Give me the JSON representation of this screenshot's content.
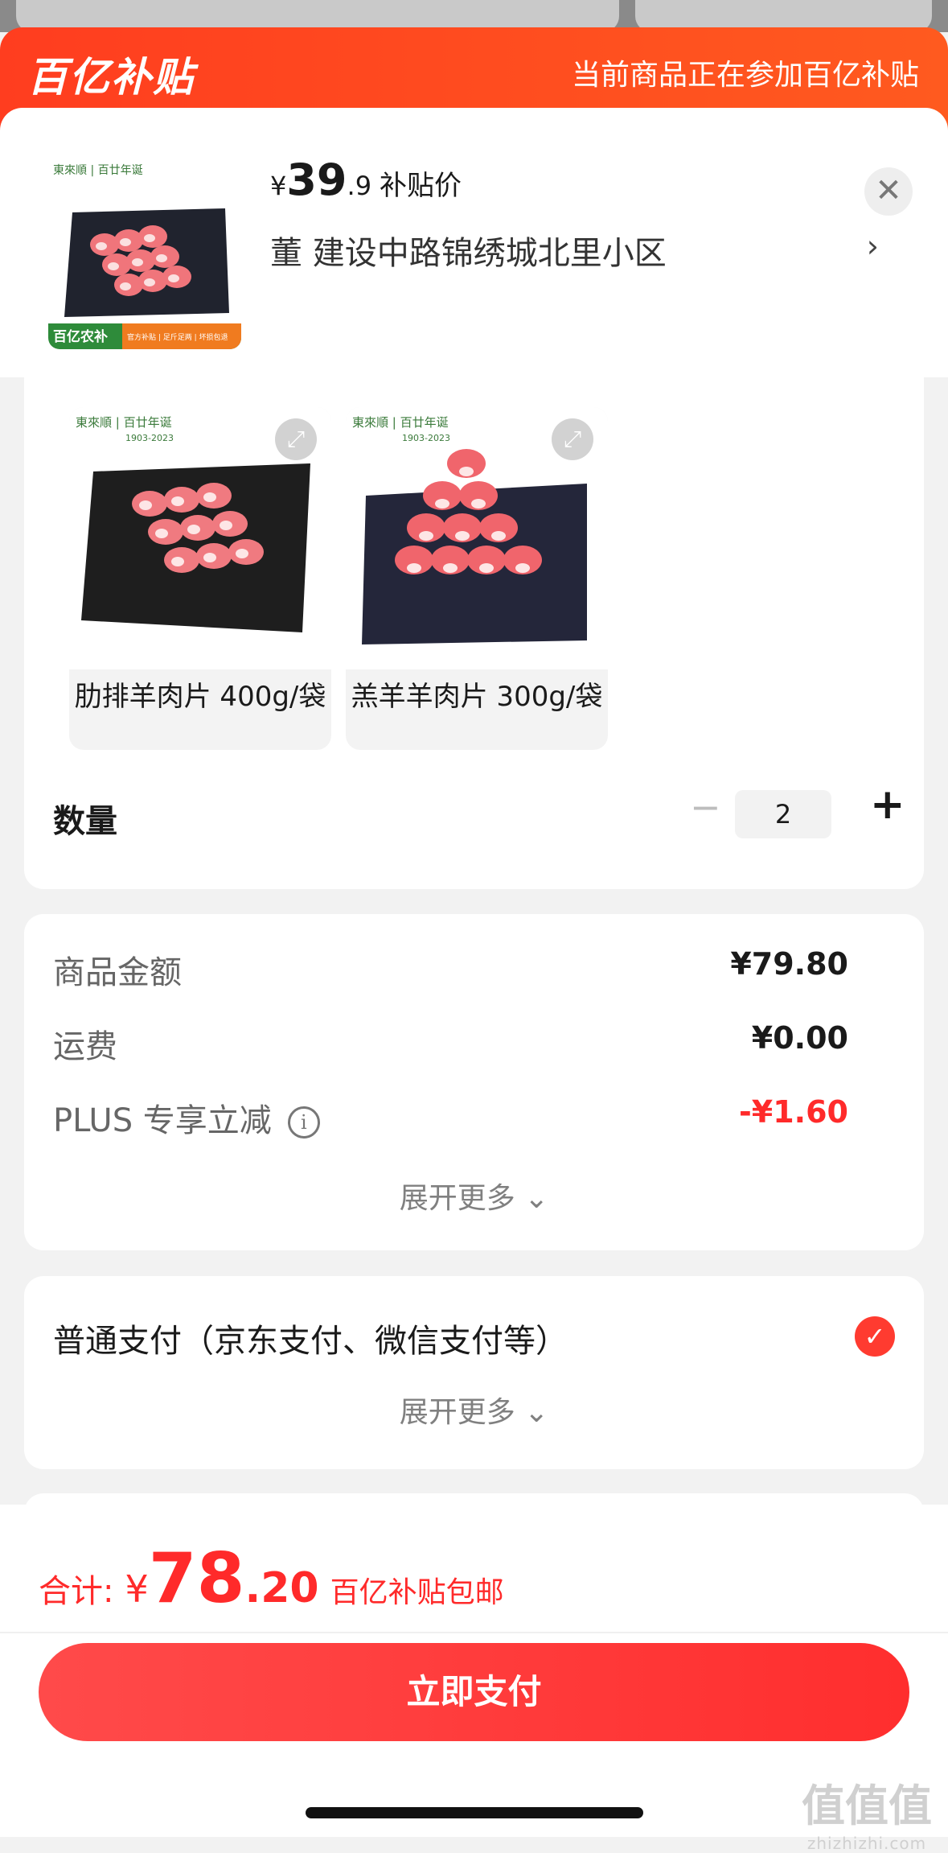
{
  "header": {
    "logo": "百亿补贴",
    "note": "当前商品正在参加百亿补贴"
  },
  "product": {
    "price_yen": "¥",
    "price_int": "39",
    "price_dec": ".9",
    "price_tag": "补贴价",
    "address": "董  建设中路锦绣城北里小区",
    "thumb_brand": "東來順 | 百廿年诞",
    "thumb_badge": "百亿农补",
    "thumb_badge_extra": "官方补贴 | 足斤足两 | 坏损包退"
  },
  "variants": [
    {
      "label": "肋排羊肉片 400g/袋",
      "brand": "東來順 | 百廿年诞",
      "years": "1903-2023"
    },
    {
      "label": "羔羊羊肉片 300g/袋",
      "brand": "東來順 | 百廿年诞",
      "years": "1903-2023"
    }
  ],
  "quantity": {
    "label": "数量",
    "minus": "−",
    "value": "2",
    "plus": "+"
  },
  "fees": {
    "items": [
      {
        "label": "商品金额",
        "value": "¥79.80"
      },
      {
        "label": "运费",
        "value": "¥0.00"
      },
      {
        "label": "PLUS 专享立减",
        "value": "-¥1.60"
      }
    ],
    "more": "展开更多 ⌄"
  },
  "payment": {
    "label": "普通支付（京东支付、微信支付等）",
    "more": "展开更多 ⌄"
  },
  "footer": {
    "total_label": "合计:",
    "total_yen": "¥",
    "total_int": "78",
    "total_dec": ".20",
    "total_note": "百亿补贴包邮",
    "pay_button": "立即支付"
  },
  "watermark": {
    "text": "值值值",
    "url": "zhizhizhi.com"
  },
  "colors": {
    "brand_orange": "#ff4a1f",
    "accent_red": "#ff2a2a"
  },
  "icons": [
    "close-icon",
    "chevron-right-icon",
    "expand-icon",
    "info-icon",
    "check-icon",
    "chevron-down-icon"
  ]
}
